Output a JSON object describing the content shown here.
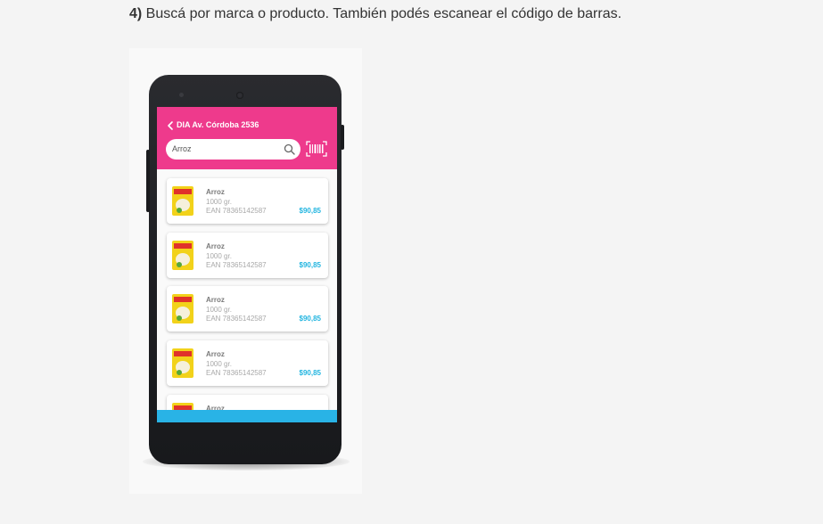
{
  "instruction": {
    "step": "4)",
    "text": " Buscá por marca o producto. También podés escanear el código de barras."
  },
  "app": {
    "header_color": "#ee3a8c",
    "bottom_bar_color": "#29b3e6",
    "price_color": "#22b5e0",
    "back_icon": "chevron-left-icon",
    "store_name": "DIA Av. Córdoba 2536",
    "search": {
      "value": "Arroz",
      "icon": "search-icon"
    },
    "barcode_icon": "barcode-scan-icon",
    "products": [
      {
        "name": "Arroz",
        "weight": "1000 gr.",
        "ean": "EAN 78365142587",
        "price": "$90,85"
      },
      {
        "name": "Arroz",
        "weight": "1000 gr.",
        "ean": "EAN 78365142587",
        "price": "$90,85"
      },
      {
        "name": "Arroz",
        "weight": "1000 gr.",
        "ean": "EAN 78365142587",
        "price": "$90,85"
      },
      {
        "name": "Arroz",
        "weight": "1000 gr.",
        "ean": "EAN 78365142587",
        "price": "$90,85"
      },
      {
        "name": "Arroz",
        "weight": "",
        "ean": "",
        "price": ""
      }
    ]
  }
}
